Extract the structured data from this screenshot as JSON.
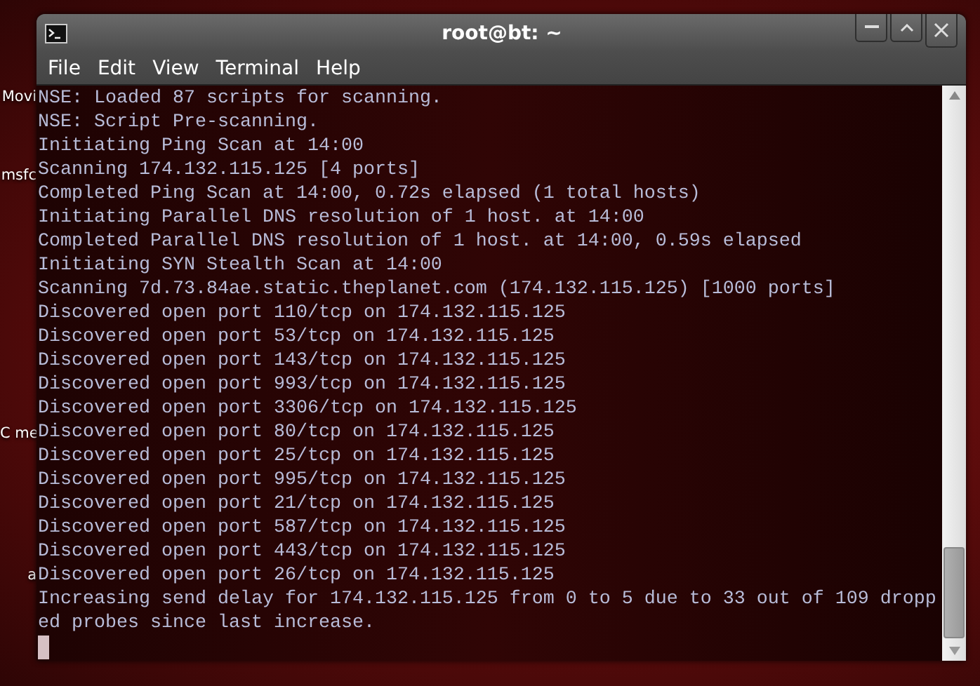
{
  "desktop_icons": [
    {
      "label": "Movi"
    },
    {
      "label": "msfc"
    },
    {
      "label": "C me"
    },
    {
      "label": "a"
    }
  ],
  "window": {
    "title": "root@bt: ~"
  },
  "menu": [
    "File",
    "Edit",
    "View",
    "Terminal",
    "Help"
  ],
  "terminal": {
    "lines": [
      "NSE: Loaded 87 scripts for scanning.",
      "NSE: Script Pre-scanning.",
      "Initiating Ping Scan at 14:00",
      "Scanning 174.132.115.125 [4 ports]",
      "Completed Ping Scan at 14:00, 0.72s elapsed (1 total hosts)",
      "Initiating Parallel DNS resolution of 1 host. at 14:00",
      "Completed Parallel DNS resolution of 1 host. at 14:00, 0.59s elapsed",
      "Initiating SYN Stealth Scan at 14:00",
      "Scanning 7d.73.84ae.static.theplanet.com (174.132.115.125) [1000 ports]",
      "Discovered open port 110/tcp on 174.132.115.125",
      "Discovered open port 53/tcp on 174.132.115.125",
      "Discovered open port 143/tcp on 174.132.115.125",
      "Discovered open port 993/tcp on 174.132.115.125",
      "Discovered open port 3306/tcp on 174.132.115.125",
      "Discovered open port 80/tcp on 174.132.115.125",
      "Discovered open port 25/tcp on 174.132.115.125",
      "Discovered open port 995/tcp on 174.132.115.125",
      "Discovered open port 21/tcp on 174.132.115.125",
      "Discovered open port 587/tcp on 174.132.115.125",
      "Discovered open port 443/tcp on 174.132.115.125",
      "Discovered open port 26/tcp on 174.132.115.125",
      "Increasing send delay for 174.132.115.125 from 0 to 5 due to 33 out of 109 dropp",
      "ed probes since last increase."
    ]
  }
}
